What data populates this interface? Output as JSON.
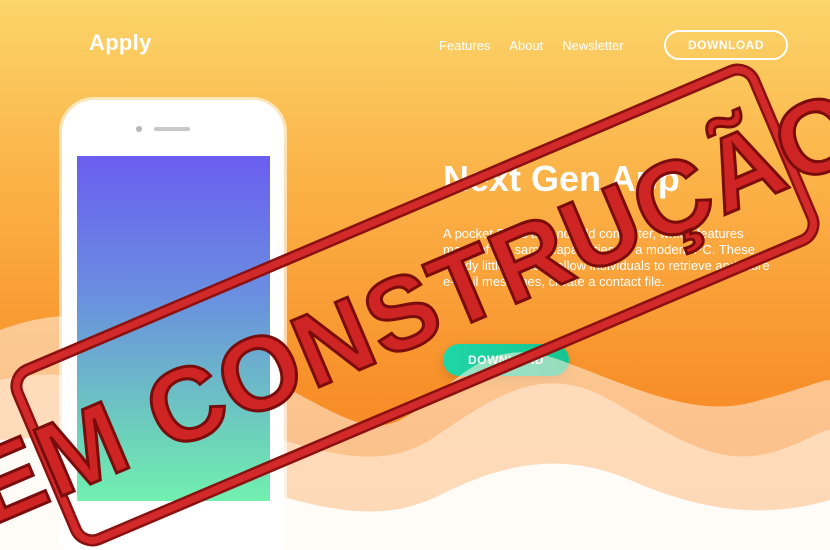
{
  "brand": {
    "name": "Apply"
  },
  "nav": {
    "items": [
      {
        "label": "Features"
      },
      {
        "label": "About"
      },
      {
        "label": "Newsletter"
      }
    ],
    "cta_label": "DOWNLOAD"
  },
  "hero": {
    "headline": "Next Gen App",
    "description": "A pocket PC is a handheld computer, which features many of the same capabilities as a modern PC. These handy little devices allow individuals to retrieve and store e-mail messages, create a contact file.",
    "cta_label": "DOWNLOAD"
  },
  "overlay": {
    "stamp_text": "EM CONSTRUÇÃO",
    "stamp_color": "#c41e1e"
  },
  "colors": {
    "background_top": "#fbd56a",
    "background_bottom": "#f77e1f",
    "accent": "#1fd7a6"
  }
}
